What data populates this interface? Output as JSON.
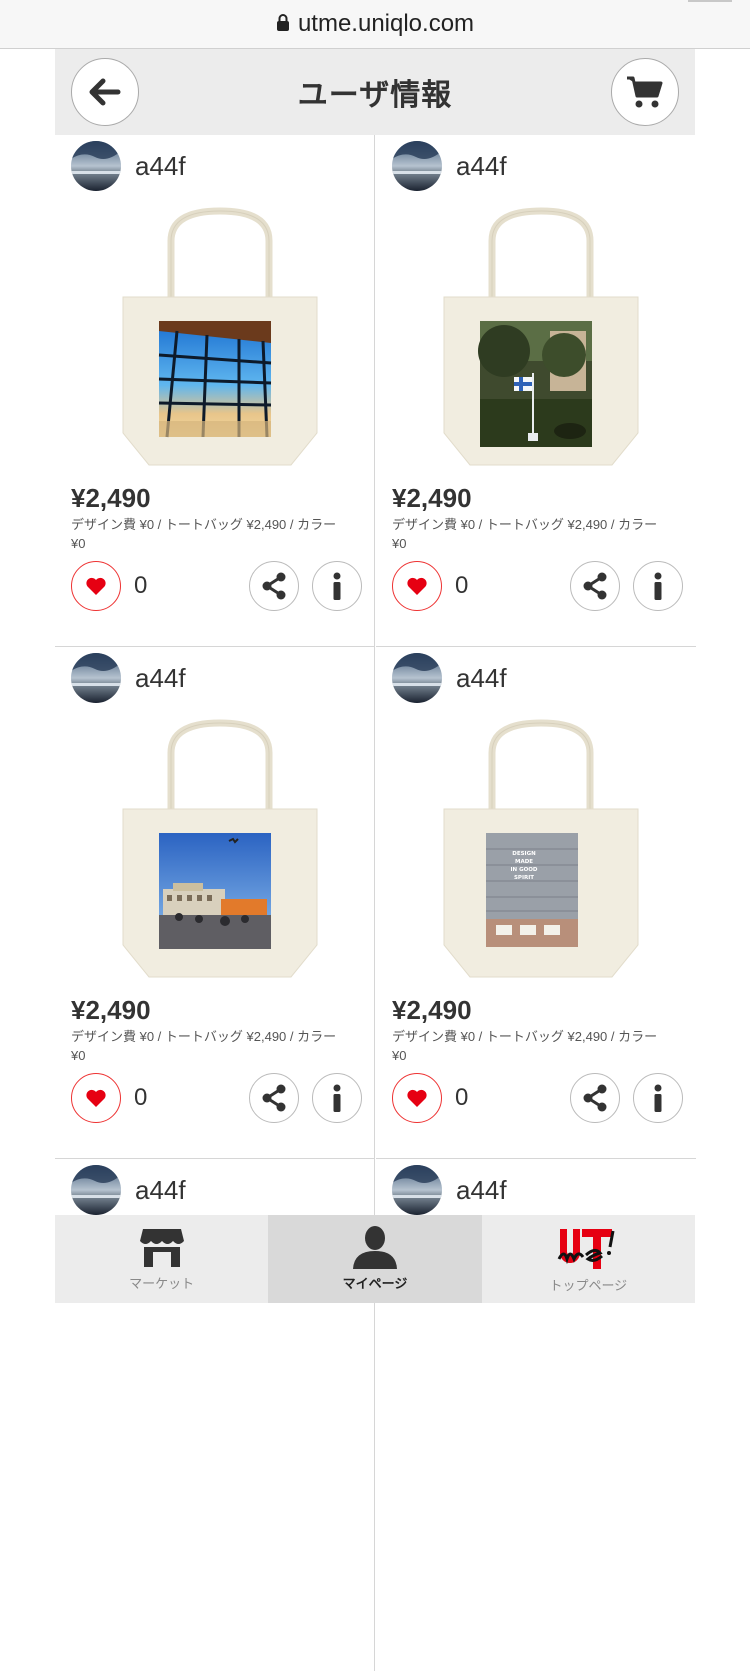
{
  "browser": {
    "url": "utme.uniqlo.com"
  },
  "header": {
    "title": "ユーザ情報"
  },
  "cards": [
    {
      "username": "a44f",
      "price": "¥2,490",
      "desc": "デザイン費 ¥0 / トートバッグ ¥2,490 / カラー ¥0",
      "likes": "0",
      "image": "airport-window"
    },
    {
      "username": "a44f",
      "price": "¥2,490",
      "desc": "デザイン費 ¥0 / トートバッグ ¥2,490 / カラー ¥0",
      "likes": "0",
      "image": "finnish-flag-park"
    },
    {
      "username": "a44f",
      "price": "¥2,490",
      "desc": "デザイン費 ¥0 / トートバッグ ¥2,490 / カラー ¥0",
      "likes": "0",
      "image": "market-square"
    },
    {
      "username": "a44f",
      "price": "¥2,490",
      "desc": "デザイン費 ¥0 / トートバッグ ¥2,490 / カラー ¥0",
      "likes": "0",
      "image": "storefront-window"
    },
    {
      "username": "a44f"
    },
    {
      "username": "a44f"
    }
  ],
  "tabbar": {
    "market": "マーケット",
    "mypage": "マイページ",
    "toppage": "トップページ"
  },
  "colors": {
    "accent": "#e60012",
    "header_bg": "#ececec",
    "like_red": "#e33333"
  }
}
